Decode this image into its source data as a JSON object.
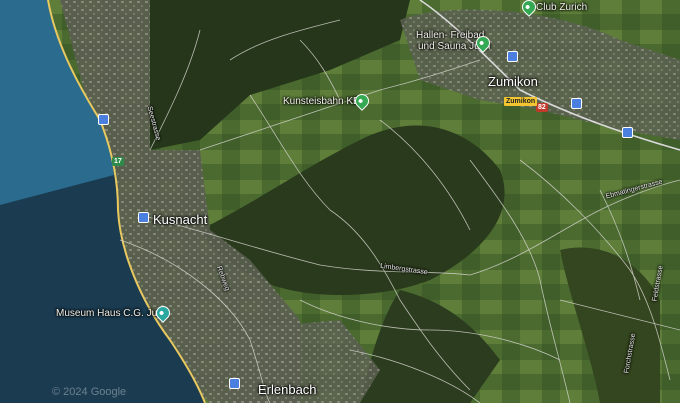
{
  "map": {
    "copyright": "© 2024 Google",
    "places": {
      "kusnacht": "Kusnacht",
      "zumikon": "Zumikon",
      "erlenbach": "Erlenbach"
    },
    "pois": {
      "museum": "Museum Haus C.G. Jung",
      "kunsteisbahn": "Kunsteisbahn KEK",
      "freibad_line1": "Hallen- Freibad",
      "freibad_line2": "und Sauna Juch",
      "golf": "Club Zurich"
    },
    "streets": {
      "limberg": "Limbergstrasse",
      "ebmatingen": "Ebmatingerstrasse",
      "forch": "Forchstrasse",
      "rebweg": "Rebweg",
      "seestrasse": "Seestrasse",
      "zumikon_sign": "Zumikon",
      "feld": "Feldstrasse"
    },
    "shields": {
      "road17": "17",
      "road82": "82"
    },
    "colors": {
      "lake": "#1a3a4e",
      "lake_light": "#2a6a8c",
      "forest": "#2a3a1e",
      "field": "#5a7a3a",
      "road_main": "#e8c860",
      "road_minor": "#d8d8d8",
      "pin_green": "#34a853",
      "bus_blue": "#4a7fe0"
    }
  }
}
